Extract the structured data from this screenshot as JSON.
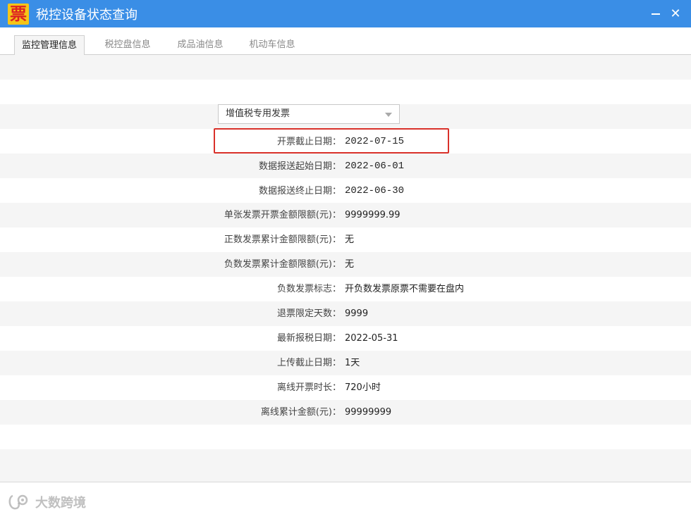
{
  "window": {
    "title": "税控设备状态查询",
    "icon_char": "票",
    "minimize_icon": "minimize-icon",
    "close_icon": "close-icon",
    "close_char": "✕"
  },
  "tabs": [
    {
      "label": "监控管理信息",
      "active": true
    },
    {
      "label": "税控盘信息",
      "active": false
    },
    {
      "label": "成品油信息",
      "active": false
    },
    {
      "label": "机动车信息",
      "active": false
    }
  ],
  "invoice_type_select": {
    "selected": "增值税专用发票"
  },
  "fields": [
    {
      "label": "开票截止日期：",
      "value": "2022-07-15",
      "highlighted": true
    },
    {
      "label": "数据报送起始日期：",
      "value": "2022-06-01"
    },
    {
      "label": "数据报送终止日期：",
      "value": "2022-06-30"
    },
    {
      "label": "单张发票开票金额限额(元)：",
      "value": "9999999.99"
    },
    {
      "label": "正数发票累计金额限额(元)：",
      "value": "无"
    },
    {
      "label": "负数发票累计金额限额(元)：",
      "value": "无"
    },
    {
      "label": "负数发票标志：",
      "value": "开负数发票原票不需要在盘内"
    },
    {
      "label": "退票限定天数：",
      "value": "9999"
    },
    {
      "label": "最新报税日期：",
      "value": "2022-05-31"
    },
    {
      "label": "上传截止日期：",
      "value": "1天"
    },
    {
      "label": "离线开票时长：",
      "value": "720小时"
    },
    {
      "label": "离线累计金额(元)：",
      "value": "99999999"
    }
  ],
  "watermark": {
    "text": "大数跨境"
  },
  "colors": {
    "titlebar": "#3a8ee6",
    "highlight_border": "#d9312a",
    "stripe": "#f5f5f5"
  }
}
